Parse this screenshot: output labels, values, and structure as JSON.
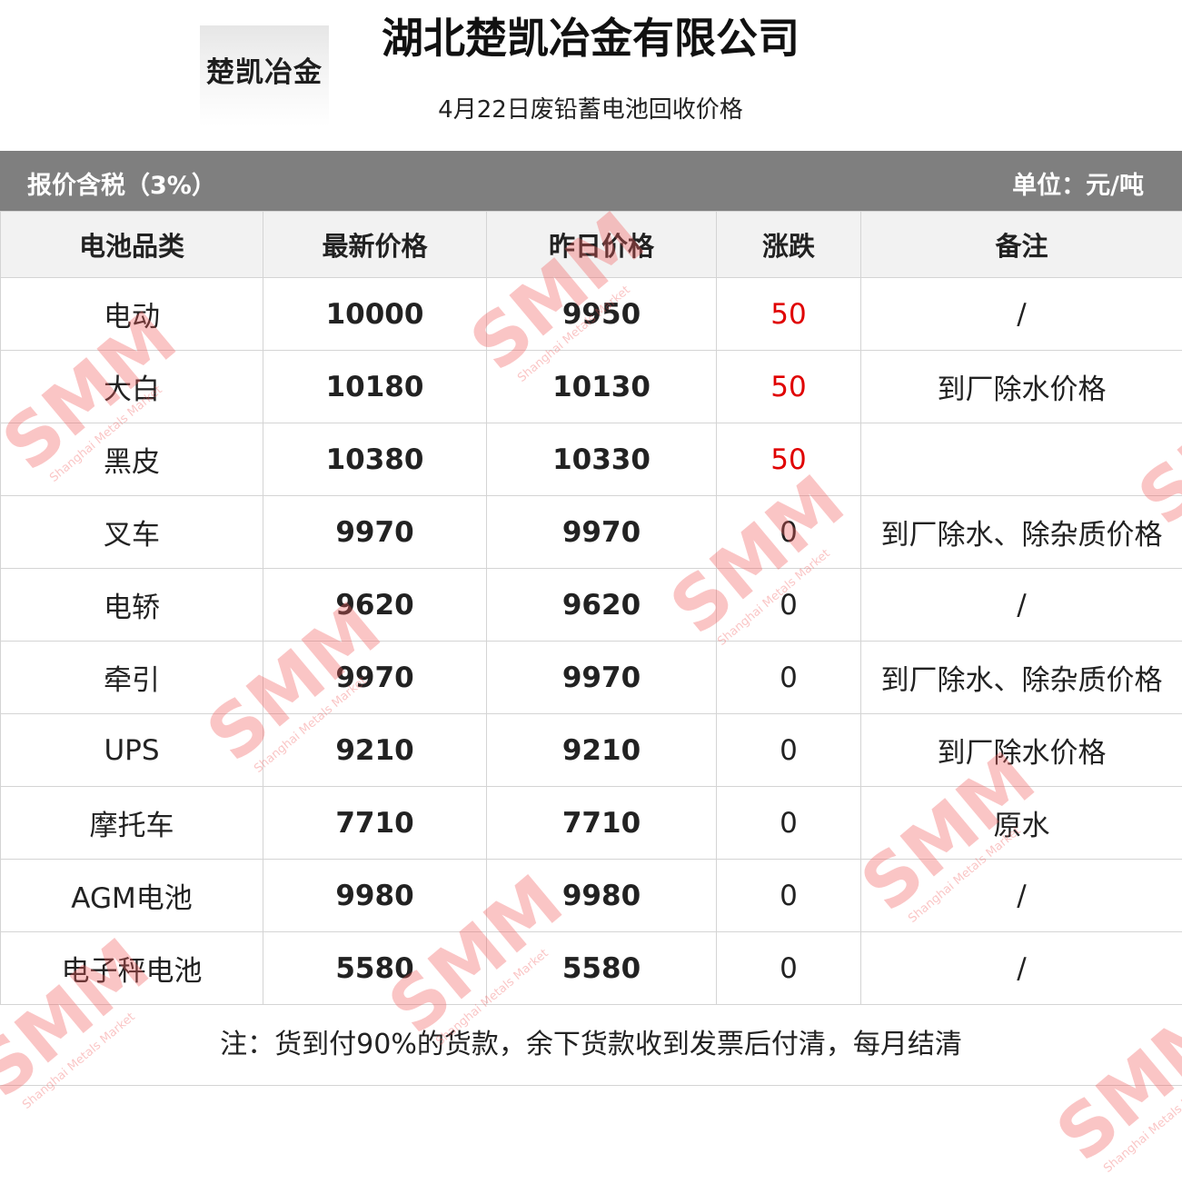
{
  "logo": {
    "text": "楚凯冶金"
  },
  "title": "湖北楚凯冶金有限公司",
  "subtitle": "4月22日废铅蓄电池回收价格",
  "bar": {
    "left": "报价含税（3%）",
    "right": "单位：元/吨"
  },
  "table": {
    "headers": [
      "电池品类",
      "最新价格",
      "昨日价格",
      "涨跌",
      "备注"
    ],
    "rows": [
      {
        "category": "电动",
        "latest": "10000",
        "yesterday": "9950",
        "change": "50",
        "change_color": "#e00000",
        "note": "/"
      },
      {
        "category": "大白",
        "latest": "10180",
        "yesterday": "10130",
        "change": "50",
        "change_color": "#e00000",
        "note": "到厂除水价格"
      },
      {
        "category": "黑皮",
        "latest": "10380",
        "yesterday": "10330",
        "change": "50",
        "change_color": "#e00000",
        "note": ""
      },
      {
        "category": "叉车",
        "latest": "9970",
        "yesterday": "9970",
        "change": "0",
        "change_color": "#222222",
        "note": "到厂除水、除杂质价格"
      },
      {
        "category": "电轿",
        "latest": "9620",
        "yesterday": "9620",
        "change": "0",
        "change_color": "#222222",
        "note": "/"
      },
      {
        "category": "牵引",
        "latest": "9970",
        "yesterday": "9970",
        "change": "0",
        "change_color": "#222222",
        "note": "到厂除水、除杂质价格"
      },
      {
        "category": "UPS",
        "latest": "9210",
        "yesterday": "9210",
        "change": "0",
        "change_color": "#222222",
        "note": "到厂除水价格"
      },
      {
        "category": "摩托车",
        "latest": "7710",
        "yesterday": "7710",
        "change": "0",
        "change_color": "#222222",
        "note": "原水"
      },
      {
        "category": "AGM电池",
        "latest": "9980",
        "yesterday": "9980",
        "change": "0",
        "change_color": "#222222",
        "note": "/"
      },
      {
        "category": "电子秤电池",
        "latest": "5580",
        "yesterday": "5580",
        "change": "0",
        "change_color": "#222222",
        "note": "/"
      }
    ]
  },
  "footnote": "注：货到付90%的货款，余下货款收到发票后付清，每月结清",
  "watermark": {
    "brand": "SMM",
    "tagline": "Shanghai Metals Market",
    "color": "#f25c5c"
  }
}
